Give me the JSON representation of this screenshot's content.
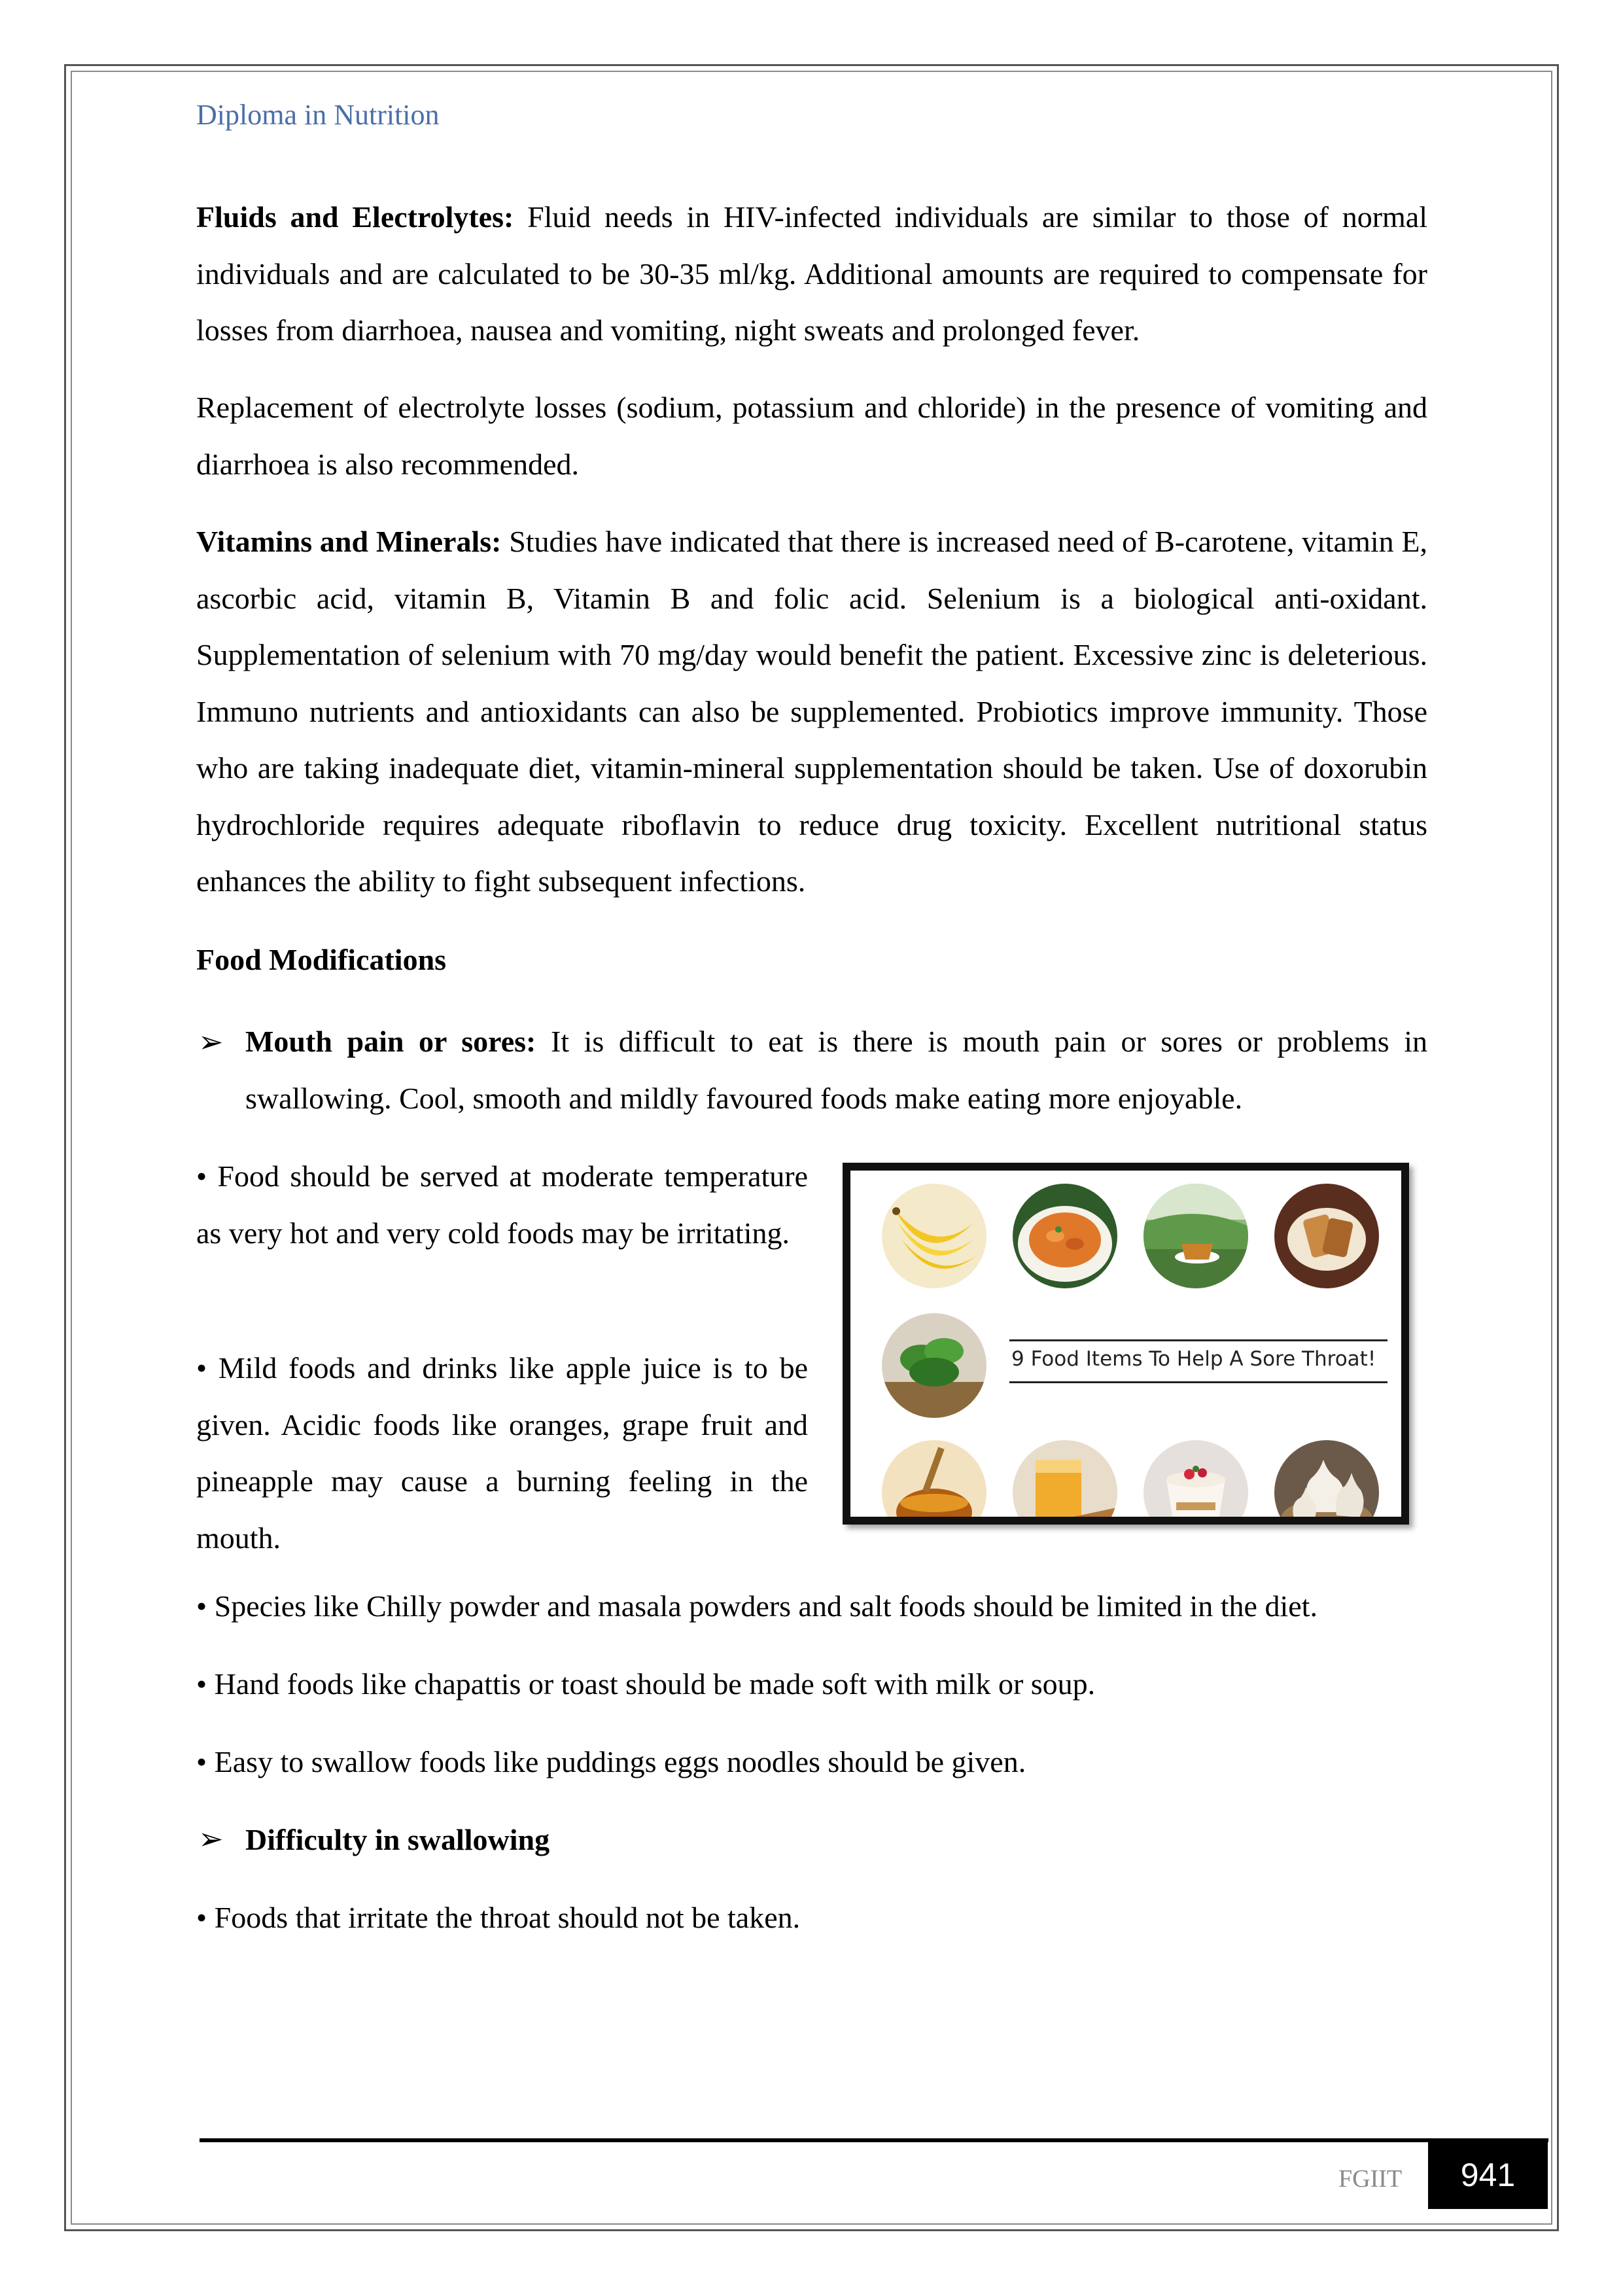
{
  "header": {
    "title": "Diploma in Nutrition"
  },
  "sections": {
    "fluids": {
      "label": "Fluids and Electrolytes:",
      "text": " Fluid needs in HIV-infected individuals are similar to those of normal individuals and are calculated to be 30-35 ml/kg. Additional amounts are required to compensate for losses from diarrhoea, nausea and vomiting, night sweats and prolonged fever."
    },
    "electrolytes": {
      "text": "Replacement of electrolyte losses (sodium, potassium and chloride) in the presence of vomiting and diarrhoea is also recommended."
    },
    "vitamins": {
      "label": "Vitamins and Minerals:",
      "text": " Studies have indicated that there is increased need of B-carotene, vitamin E, ascorbic acid, vitamin B, Vitamin B and folic acid. Selenium is a biological anti-oxidant. Supplementation of selenium with 70 mg/day would benefit the patient. Excessive zinc is deleterious. Immuno nutrients and antioxidants can also be supplemented. Probiotics improve immunity. Those who are taking inadequate diet, vitamin-mineral supplementation should be taken. Use of doxorubin hydrochloride requires adequate riboflavin to reduce drug toxicity. Excellent nutritional status enhances the ability to fight subsequent infections."
    },
    "food_mod_heading": "Food Modifications",
    "mouth_pain": {
      "arrow": "➢",
      "label": "Mouth pain or sores:",
      "text": " It is difficult to eat is there is mouth pain or sores or problems in swallowing. Cool, smooth and mildly favoured foods make eating more enjoyable."
    },
    "bullets_wrapped": [
      "• Food should be served at moderate temperature as very hot and very cold foods may be irritating.",
      "• Mild foods and drinks like apple juice is to be given. Acidic foods like oranges, grape fruit and pineapple may cause a burning feeling in the mouth."
    ],
    "bullets_full": [
      "• Species like Chilly powder and masala powders and salt foods should be limited in the diet.",
      "• Hand foods like chapattis or toast should be made soft with milk or soup.",
      "• Easy to swallow foods like puddings eggs noodles should be given."
    ],
    "swallowing": {
      "arrow": "➢",
      "label": "Difficulty in swallowing"
    },
    "bullet_last": "• Foods that irritate the throat should not be taken."
  },
  "figure": {
    "caption": "9 Food Items To Help A Sore Throat!",
    "items": [
      "banana-image",
      "carrot-dish-image",
      "tea-image",
      "bread-image",
      "greens-image",
      "honey-image",
      "juice-image",
      "yogurt-image",
      "garlic-image"
    ]
  },
  "footer": {
    "label": "FGIIT",
    "page_number": "941"
  }
}
